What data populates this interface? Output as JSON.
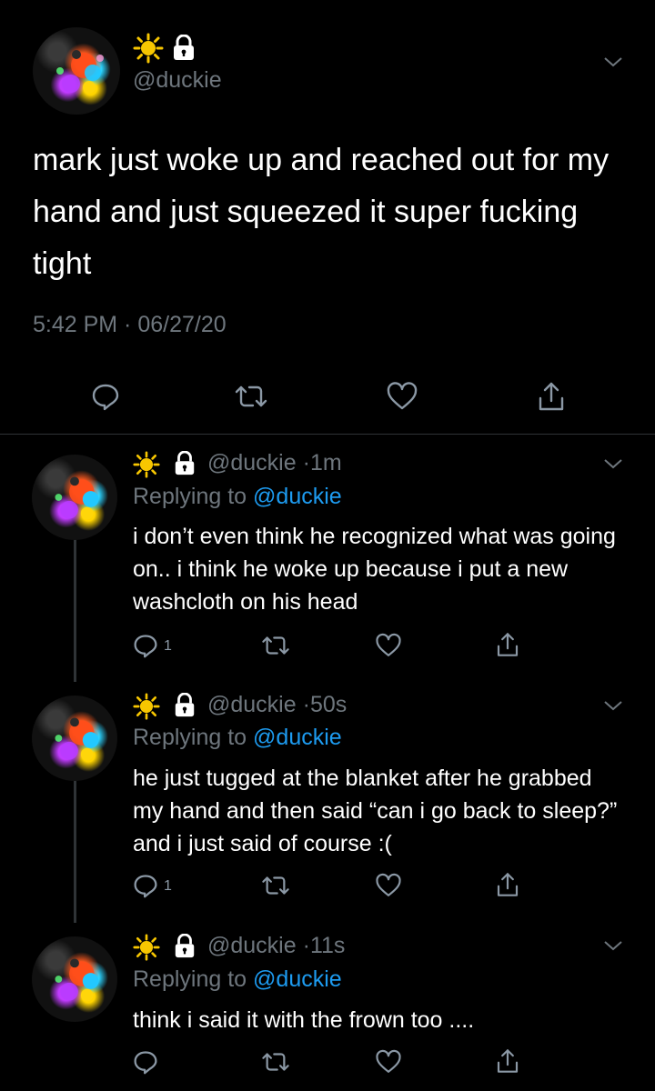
{
  "main_tweet": {
    "handle": "@duckie",
    "text": "mark just woke up and reached out for my hand and just squeezed it super fucking tight",
    "timestamp": "5:42 PM · 06/27/20"
  },
  "replies": [
    {
      "handle": "@duckie",
      "sep": "·",
      "time": "1m",
      "replying_label": "Replying to",
      "replying_handle": "@duckie",
      "text": "i don’t even think he recognized what was going on.. i think he woke up because i put a new washcloth on his head",
      "reply_count": "1"
    },
    {
      "handle": "@duckie",
      "sep": "·",
      "time": "50s",
      "replying_label": "Replying to",
      "replying_handle": "@duckie",
      "text": "he just tugged at the blanket after he grabbed my hand and then said “can i go back to sleep?” and i just said of course :(",
      "reply_count": "1"
    },
    {
      "handle": "@duckie",
      "sep": "·",
      "time": "11s",
      "replying_label": "Replying to",
      "replying_handle": "@duckie",
      "text": "think i said it with the frown too ....",
      "reply_count": ""
    }
  ],
  "icons": {
    "name_emoji": "sun-icon",
    "protected": "lock-icon",
    "more": "chevron-down-icon",
    "reply": "reply-icon",
    "retweet": "retweet-icon",
    "like": "heart-icon",
    "share": "share-icon"
  },
  "colors": {
    "background": "#000000",
    "text": "#ffffff",
    "muted": "#6e767d",
    "link": "#1d9bf0",
    "divider": "#2f3336"
  }
}
